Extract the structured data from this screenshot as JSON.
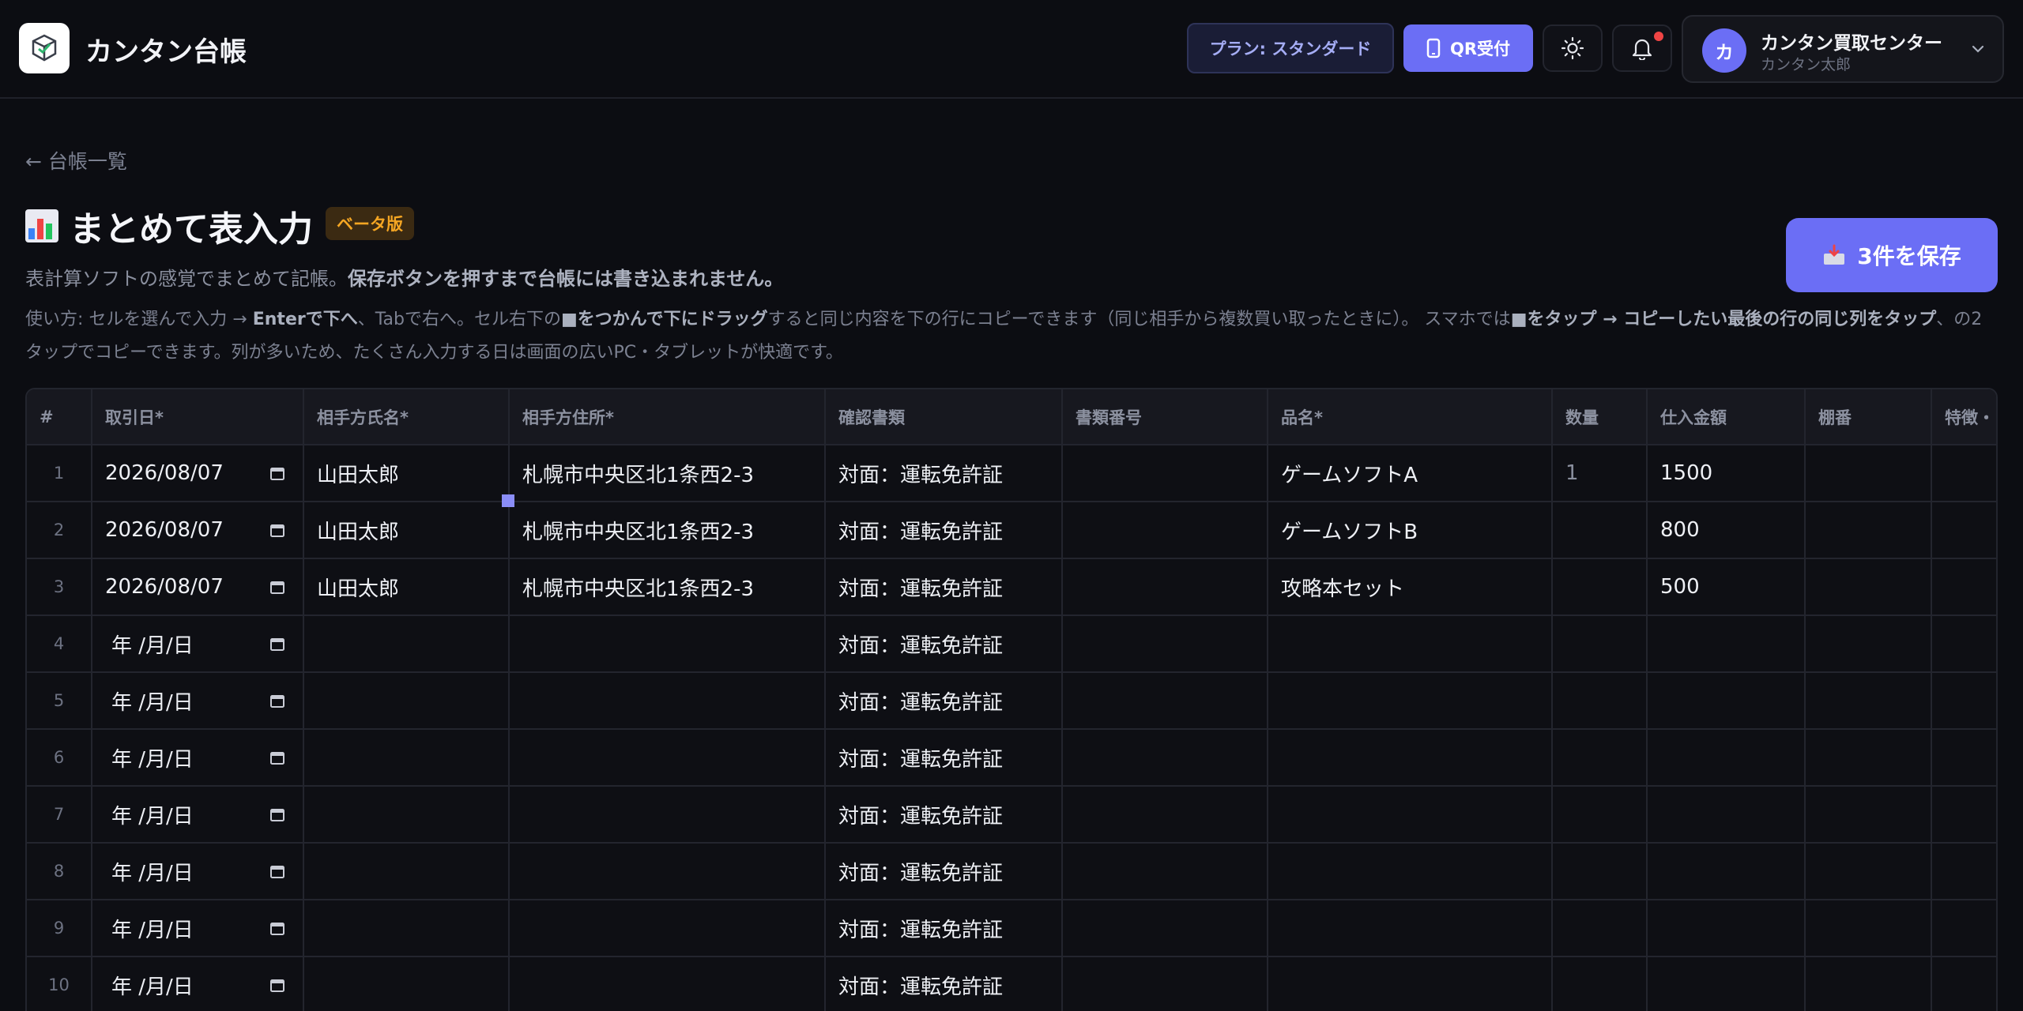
{
  "app": {
    "title": "カンタン台帳"
  },
  "header": {
    "plan_label": "プラン: スタンダード",
    "qr_label": "QR受付",
    "account_initial": "カ",
    "account_name": "カンタン買取センター",
    "account_user": "カンタン太郎"
  },
  "page": {
    "back_label": "← 台帳一覧",
    "title": "まとめて表入力",
    "beta_label": "ベータ版",
    "save_label": "3件を保存",
    "subtitle_plain": "表計算ソフトの感覚でまとめて記帳。",
    "subtitle_bold": "保存ボタンを押すまで台帳には書き込まれません。",
    "help": {
      "p1": "使い方: セルを選んで入力 → ",
      "b1": "Enterで下へ",
      "p2": "、Tabで右へ。セル右下の",
      "b2": "■をつかんで下にドラッグ",
      "p3": "すると同じ内容を下の行にコピーできます（同じ相手から複数買い取ったときに）。 スマホでは",
      "b3": "■をタップ → コピーしたい最後の行の同じ列をタップ",
      "p4": "、の2タップでコピーできます。列が多いため、たくさん入力する日は画面の広いPC・タブレットが快適です。"
    }
  },
  "table": {
    "columns": [
      "#",
      "取引日*",
      "相手方氏名*",
      "相手方住所*",
      "確認書類",
      "書類番号",
      "品名*",
      "数量",
      "仕入金額",
      "棚番",
      "特徴・"
    ],
    "rows": [
      {
        "n": "1",
        "date": "2026/08/07",
        "name": "山田太郎",
        "addr": "札幌市中央区北1条西2-3",
        "doc": "対面：運転免許証",
        "docno": "",
        "item": "ゲームソフトA",
        "qty": "1",
        "price": "1500",
        "shelf": "",
        "note": ""
      },
      {
        "n": "2",
        "date": "2026/08/07",
        "name": "山田太郎",
        "addr": "札幌市中央区北1条西2-3",
        "doc": "対面：運転免許証",
        "docno": "",
        "item": "ゲームソフトB",
        "qty": "",
        "price": "800",
        "shelf": "",
        "note": ""
      },
      {
        "n": "3",
        "date": "2026/08/07",
        "name": "山田太郎",
        "addr": "札幌市中央区北1条西2-3",
        "doc": "対面：運転免許証",
        "docno": "",
        "item": "攻略本セット",
        "qty": "",
        "price": "500",
        "shelf": "",
        "note": ""
      },
      {
        "n": "4",
        "date": "年 /月/日",
        "name": "",
        "addr": "",
        "doc": "対面：運転免許証",
        "docno": "",
        "item": "",
        "qty": "",
        "price": "",
        "shelf": "",
        "note": ""
      },
      {
        "n": "5",
        "date": "年 /月/日",
        "name": "",
        "addr": "",
        "doc": "対面：運転免許証",
        "docno": "",
        "item": "",
        "qty": "",
        "price": "",
        "shelf": "",
        "note": ""
      },
      {
        "n": "6",
        "date": "年 /月/日",
        "name": "",
        "addr": "",
        "doc": "対面：運転免許証",
        "docno": "",
        "item": "",
        "qty": "",
        "price": "",
        "shelf": "",
        "note": ""
      },
      {
        "n": "7",
        "date": "年 /月/日",
        "name": "",
        "addr": "",
        "doc": "対面：運転免許証",
        "docno": "",
        "item": "",
        "qty": "",
        "price": "",
        "shelf": "",
        "note": ""
      },
      {
        "n": "8",
        "date": "年 /月/日",
        "name": "",
        "addr": "",
        "doc": "対面：運転免許証",
        "docno": "",
        "item": "",
        "qty": "",
        "price": "",
        "shelf": "",
        "note": ""
      },
      {
        "n": "9",
        "date": "年 /月/日",
        "name": "",
        "addr": "",
        "doc": "対面：運転免許証",
        "docno": "",
        "item": "",
        "qty": "",
        "price": "",
        "shelf": "",
        "note": ""
      },
      {
        "n": "10",
        "date": "年 /月/日",
        "name": "",
        "addr": "",
        "doc": "対面：運転免許証",
        "docno": "",
        "item": "",
        "qty": "",
        "price": "",
        "shelf": "",
        "note": ""
      }
    ]
  }
}
